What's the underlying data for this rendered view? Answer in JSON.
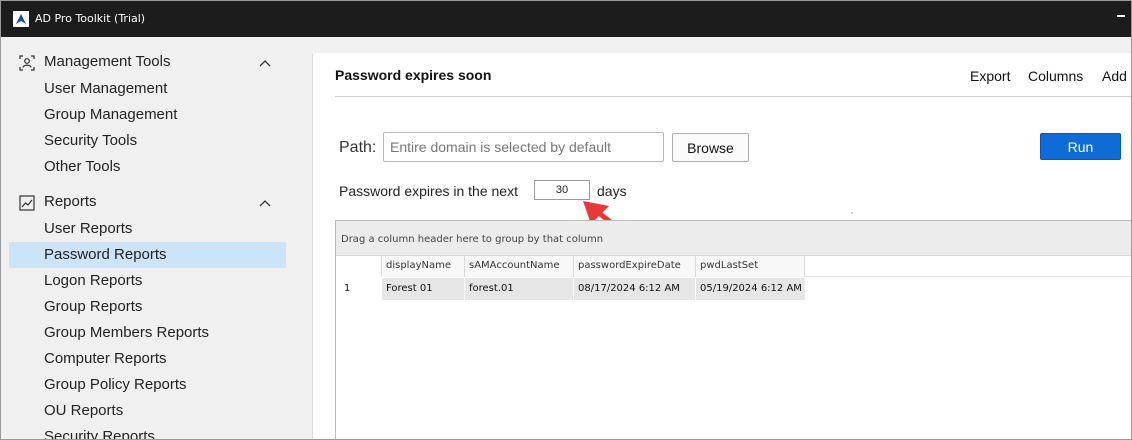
{
  "window": {
    "title": "AD Pro Toolkit (Trial)"
  },
  "sidebar": {
    "sections": [
      {
        "title": "Management Tools",
        "icon": "management-icon",
        "items": [
          "User Management",
          "Group Management",
          "Security Tools",
          "Other Tools"
        ]
      },
      {
        "title": "Reports",
        "icon": "reports-chart-icon",
        "items": [
          "User Reports",
          "Password Reports",
          "Logon Reports",
          "Group Reports",
          "Group Members Reports",
          "Computer Reports",
          "Group Policy Reports",
          "OU Reports",
          "Security Reports"
        ]
      }
    ],
    "active_item": "Password Reports"
  },
  "main": {
    "title": "Password expires soon",
    "toolbar": {
      "export": "Export",
      "columns": "Columns",
      "add": "Add"
    },
    "path_label": "Path:",
    "path_placeholder": "Entire domain is selected by default",
    "browse_label": "Browse",
    "run_label": "Run",
    "expire_label": "Password expires in the next",
    "days_value": "30",
    "days_label": "days"
  },
  "grid": {
    "group_hint": "Drag a column header here to group by that column",
    "columns": [
      "displayName",
      "sAMAccountName",
      "passwordExpireDate",
      "pwdLastSet"
    ],
    "rows": [
      {
        "num": "1",
        "displayName": "Forest 01",
        "sAMAccountName": "forest.01",
        "passwordExpireDate": "08/17/2024 6:12 AM",
        "pwdLastSet": "05/19/2024 6:12 AM"
      }
    ]
  },
  "colors": {
    "accent": "#0f6cd6",
    "active_bg": "#cce4f7",
    "annotation_arrow": "#e8383a",
    "titlebar": "#1c1c1c"
  }
}
